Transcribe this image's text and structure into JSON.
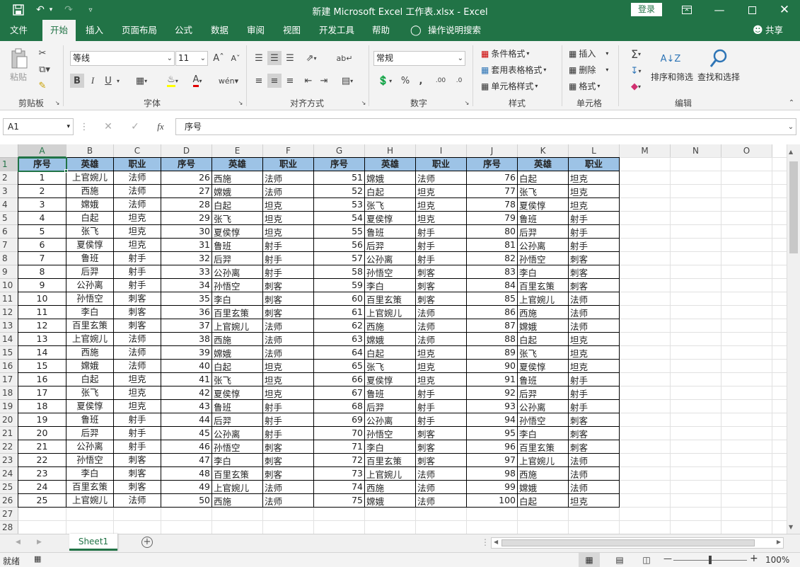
{
  "window": {
    "title": "新建 Microsoft Excel 工作表.xlsx  -  Excel",
    "login": "登录",
    "accent": "#217346"
  },
  "menu": {
    "file": "文件",
    "home": "开始",
    "insert": "插入",
    "layout": "页面布局",
    "formula": "公式",
    "data": "数据",
    "review": "审阅",
    "view": "视图",
    "developer": "开发工具",
    "help": "帮助",
    "tellme": "操作说明搜索",
    "share": "共享"
  },
  "ribbon": {
    "clipboard": {
      "label": "剪贴板",
      "paste": "粘贴"
    },
    "font": {
      "label": "字体",
      "name": "等线",
      "size": "11",
      "bold": "B",
      "italic": "I",
      "underline": "U"
    },
    "alignment": {
      "label": "对齐方式"
    },
    "number": {
      "label": "数字",
      "format": "常规"
    },
    "styles": {
      "label": "样式",
      "conditional": "条件格式",
      "table": "套用表格格式",
      "cell": "单元格样式"
    },
    "cells": {
      "label": "单元格",
      "insert": "插入",
      "delete": "删除",
      "format": "格式"
    },
    "editing": {
      "label": "编辑",
      "sort": "排序和筛选",
      "find": "查找和选择"
    }
  },
  "formula_bar": {
    "name_box": "A1",
    "content": "序号"
  },
  "columns": [
    "A",
    "B",
    "C",
    "D",
    "E",
    "F",
    "G",
    "H",
    "I",
    "J",
    "K",
    "L",
    "M",
    "N",
    "O"
  ],
  "rows": [
    "1",
    "2",
    "3",
    "4",
    "5",
    "6",
    "7",
    "8",
    "9",
    "10",
    "11",
    "12",
    "13",
    "14",
    "15",
    "16",
    "17",
    "18",
    "19",
    "20",
    "21",
    "22",
    "23",
    "24",
    "25",
    "26",
    "27",
    "28"
  ],
  "header": [
    "序号",
    "英雄",
    "职业",
    "序号",
    "英雄",
    "职业",
    "序号",
    "英雄",
    "职业",
    "序号",
    "英雄",
    "职业"
  ],
  "table_rows": [
    [
      "1",
      "上官婉儿",
      "法师",
      "26",
      "西施",
      "法师",
      "51",
      "嫦娥",
      "法师",
      "76",
      "白起",
      "坦克"
    ],
    [
      "2",
      "西施",
      "法师",
      "27",
      "嫦娥",
      "法师",
      "52",
      "白起",
      "坦克",
      "77",
      "张飞",
      "坦克"
    ],
    [
      "3",
      "嫦娥",
      "法师",
      "28",
      "白起",
      "坦克",
      "53",
      "张飞",
      "坦克",
      "78",
      "夏侯惇",
      "坦克"
    ],
    [
      "4",
      "白起",
      "坦克",
      "29",
      "张飞",
      "坦克",
      "54",
      "夏侯惇",
      "坦克",
      "79",
      "鲁班",
      "射手"
    ],
    [
      "5",
      "张飞",
      "坦克",
      "30",
      "夏侯惇",
      "坦克",
      "55",
      "鲁班",
      "射手",
      "80",
      "后羿",
      "射手"
    ],
    [
      "6",
      "夏侯惇",
      "坦克",
      "31",
      "鲁班",
      "射手",
      "56",
      "后羿",
      "射手",
      "81",
      "公孙离",
      "射手"
    ],
    [
      "7",
      "鲁班",
      "射手",
      "32",
      "后羿",
      "射手",
      "57",
      "公孙离",
      "射手",
      "82",
      "孙悟空",
      "刺客"
    ],
    [
      "8",
      "后羿",
      "射手",
      "33",
      "公孙离",
      "射手",
      "58",
      "孙悟空",
      "刺客",
      "83",
      "李白",
      "刺客"
    ],
    [
      "9",
      "公孙离",
      "射手",
      "34",
      "孙悟空",
      "刺客",
      "59",
      "李白",
      "刺客",
      "84",
      "百里玄策",
      "刺客"
    ],
    [
      "10",
      "孙悟空",
      "刺客",
      "35",
      "李白",
      "刺客",
      "60",
      "百里玄策",
      "刺客",
      "85",
      "上官婉儿",
      "法师"
    ],
    [
      "11",
      "李白",
      "刺客",
      "36",
      "百里玄策",
      "刺客",
      "61",
      "上官婉儿",
      "法师",
      "86",
      "西施",
      "法师"
    ],
    [
      "12",
      "百里玄策",
      "刺客",
      "37",
      "上官婉儿",
      "法师",
      "62",
      "西施",
      "法师",
      "87",
      "嫦娥",
      "法师"
    ],
    [
      "13",
      "上官婉儿",
      "法师",
      "38",
      "西施",
      "法师",
      "63",
      "嫦娥",
      "法师",
      "88",
      "白起",
      "坦克"
    ],
    [
      "14",
      "西施",
      "法师",
      "39",
      "嫦娥",
      "法师",
      "64",
      "白起",
      "坦克",
      "89",
      "张飞",
      "坦克"
    ],
    [
      "15",
      "嫦娥",
      "法师",
      "40",
      "白起",
      "坦克",
      "65",
      "张飞",
      "坦克",
      "90",
      "夏侯惇",
      "坦克"
    ],
    [
      "16",
      "白起",
      "坦克",
      "41",
      "张飞",
      "坦克",
      "66",
      "夏侯惇",
      "坦克",
      "91",
      "鲁班",
      "射手"
    ],
    [
      "17",
      "张飞",
      "坦克",
      "42",
      "夏侯惇",
      "坦克",
      "67",
      "鲁班",
      "射手",
      "92",
      "后羿",
      "射手"
    ],
    [
      "18",
      "夏侯惇",
      "坦克",
      "43",
      "鲁班",
      "射手",
      "68",
      "后羿",
      "射手",
      "93",
      "公孙离",
      "射手"
    ],
    [
      "19",
      "鲁班",
      "射手",
      "44",
      "后羿",
      "射手",
      "69",
      "公孙离",
      "射手",
      "94",
      "孙悟空",
      "刺客"
    ],
    [
      "20",
      "后羿",
      "射手",
      "45",
      "公孙离",
      "射手",
      "70",
      "孙悟空",
      "刺客",
      "95",
      "李白",
      "刺客"
    ],
    [
      "21",
      "公孙离",
      "射手",
      "46",
      "孙悟空",
      "刺客",
      "71",
      "李白",
      "刺客",
      "96",
      "百里玄策",
      "刺客"
    ],
    [
      "22",
      "孙悟空",
      "刺客",
      "47",
      "李白",
      "刺客",
      "72",
      "百里玄策",
      "刺客",
      "97",
      "上官婉儿",
      "法师"
    ],
    [
      "23",
      "李白",
      "刺客",
      "48",
      "百里玄策",
      "刺客",
      "73",
      "上官婉儿",
      "法师",
      "98",
      "西施",
      "法师"
    ],
    [
      "24",
      "百里玄策",
      "刺客",
      "49",
      "上官婉儿",
      "法师",
      "74",
      "西施",
      "法师",
      "99",
      "嫦娥",
      "法师"
    ],
    [
      "25",
      "上官婉儿",
      "法师",
      "50",
      "西施",
      "法师",
      "75",
      "嫦娥",
      "法师",
      "100",
      "白起",
      "坦克"
    ]
  ],
  "sheet_tab": "Sheet1",
  "status": {
    "mode": "就绪",
    "zoom": "100%"
  }
}
